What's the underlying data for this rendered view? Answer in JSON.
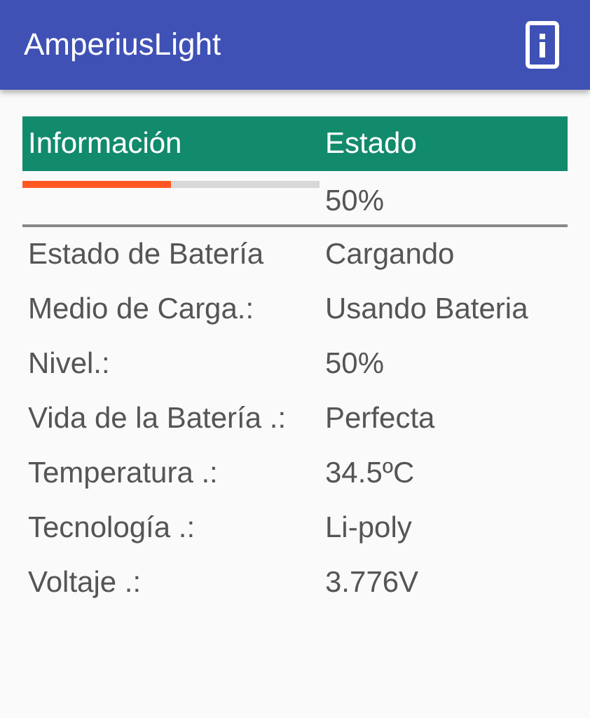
{
  "app_bar": {
    "title": "AmperiusLight"
  },
  "table": {
    "columns": [
      "Información",
      "Estado"
    ],
    "progress": {
      "level": 0.5
    },
    "progress_reading": "50%",
    "rows": [
      {
        "label": "Estado de Batería",
        "value": "Cargando"
      },
      {
        "label": "Medio de Carga.:",
        "value": "Usando Bateria"
      },
      {
        "label": "Nivel.:",
        "value": "50%"
      },
      {
        "label": "Vida de la Batería .:",
        "value": "Perfecta"
      },
      {
        "label": "Temperatura .:",
        "value": "34.5ºC"
      },
      {
        "label": "Tecnología .:",
        "value": "Li-poly"
      },
      {
        "label": "Voltaje .:",
        "value": "3.776V"
      }
    ]
  }
}
